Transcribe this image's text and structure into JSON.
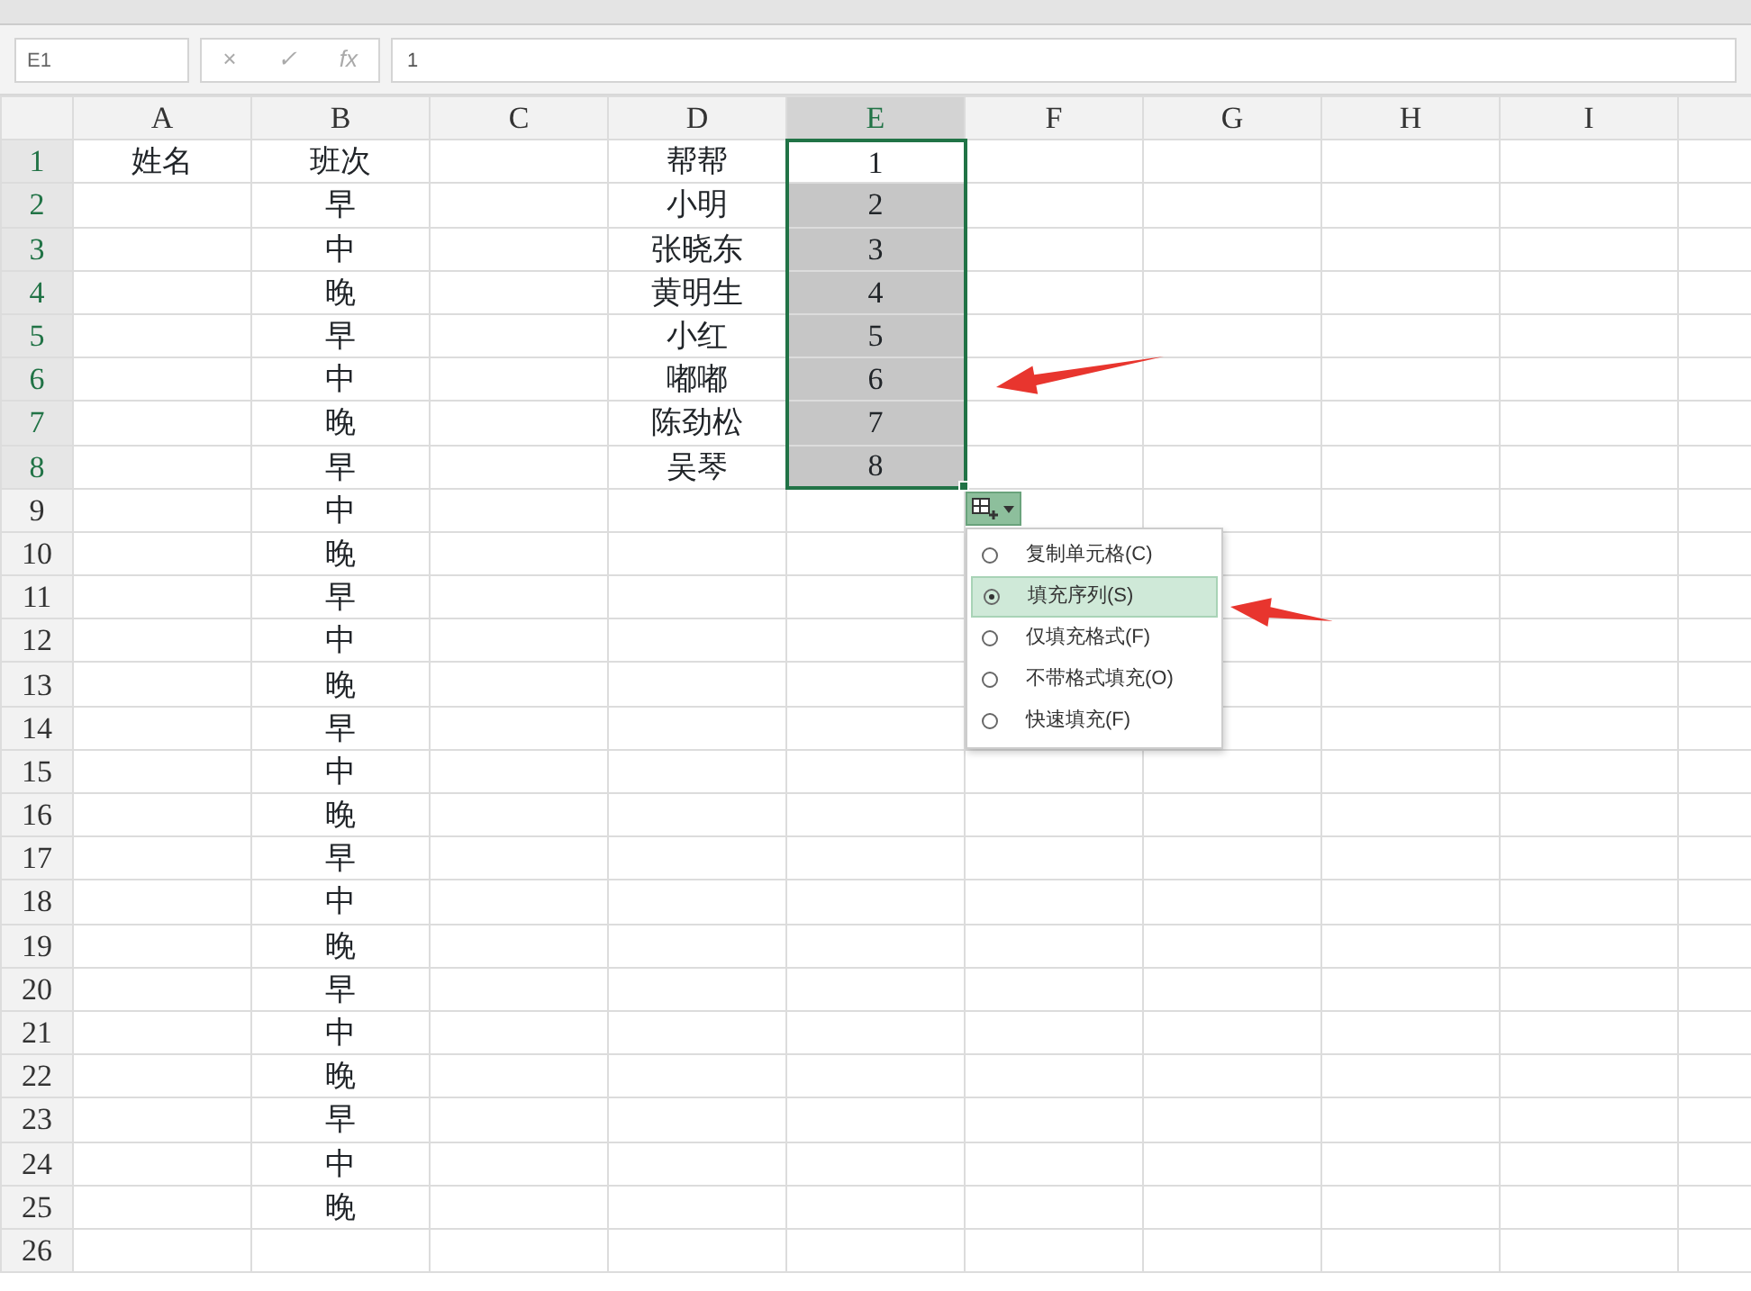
{
  "name_box": "E1",
  "formula_buttons": [
    "×",
    "✓",
    "fx"
  ],
  "formula_value": "1",
  "columns": [
    {
      "label": "A",
      "selected": false
    },
    {
      "label": "B",
      "selected": false
    },
    {
      "label": "C",
      "selected": false
    },
    {
      "label": "D",
      "selected": false
    },
    {
      "label": "E",
      "selected": true
    },
    {
      "label": "F",
      "selected": false
    },
    {
      "label": "G",
      "selected": false
    },
    {
      "label": "H",
      "selected": false
    },
    {
      "label": "I",
      "selected": false
    }
  ],
  "rows": [
    {
      "header": "1",
      "selected": true,
      "cells": [
        {
          "text": "姓名"
        },
        {
          "text": "班次"
        },
        null,
        {
          "text": "帮帮"
        },
        {
          "text": "1",
          "selected": true,
          "active": true
        }
      ]
    },
    {
      "header": "2",
      "selected": true,
      "cells": [
        null,
        {
          "text": "早"
        },
        null,
        {
          "text": "小明"
        },
        {
          "text": "2",
          "selected": true,
          "active": false
        }
      ]
    },
    {
      "header": "3",
      "selected": true,
      "cells": [
        null,
        {
          "text": "中"
        },
        null,
        {
          "text": "张晓东"
        },
        {
          "text": "3",
          "selected": true,
          "active": false
        }
      ]
    },
    {
      "header": "4",
      "selected": true,
      "cells": [
        null,
        {
          "text": "晚"
        },
        null,
        {
          "text": "黄明生"
        },
        {
          "text": "4",
          "selected": true,
          "active": false
        }
      ]
    },
    {
      "header": "5",
      "selected": true,
      "cells": [
        null,
        {
          "text": "早"
        },
        null,
        {
          "text": "小红"
        },
        {
          "text": "5",
          "selected": true,
          "active": false
        }
      ]
    },
    {
      "header": "6",
      "selected": true,
      "cells": [
        null,
        {
          "text": "中"
        },
        null,
        {
          "text": "嘟嘟"
        },
        {
          "text": "6",
          "selected": true,
          "active": false
        }
      ]
    },
    {
      "header": "7",
      "selected": true,
      "cells": [
        null,
        {
          "text": "晚"
        },
        null,
        {
          "text": "陈劲松"
        },
        {
          "text": "7",
          "selected": true,
          "active": false
        }
      ]
    },
    {
      "header": "8",
      "selected": true,
      "cells": [
        null,
        {
          "text": "早"
        },
        null,
        {
          "text": "吴琴"
        },
        {
          "text": "8",
          "selected": true,
          "active": false
        }
      ]
    },
    {
      "header": "9",
      "selected": false,
      "cells": [
        null,
        {
          "text": "中"
        }
      ]
    },
    {
      "header": "10",
      "selected": false,
      "cells": [
        null,
        {
          "text": "晚"
        }
      ]
    },
    {
      "header": "11",
      "selected": false,
      "cells": [
        null,
        {
          "text": "早"
        }
      ]
    },
    {
      "header": "12",
      "selected": false,
      "cells": [
        null,
        {
          "text": "中"
        }
      ]
    },
    {
      "header": "13",
      "selected": false,
      "cells": [
        null,
        {
          "text": "晚"
        }
      ]
    },
    {
      "header": "14",
      "selected": false,
      "cells": [
        null,
        {
          "text": "早"
        }
      ]
    },
    {
      "header": "15",
      "selected": false,
      "cells": [
        null,
        {
          "text": "中"
        }
      ]
    },
    {
      "header": "16",
      "selected": false,
      "cells": [
        null,
        {
          "text": "晚"
        }
      ]
    },
    {
      "header": "17",
      "selected": false,
      "cells": [
        null,
        {
          "text": "早"
        }
      ]
    },
    {
      "header": "18",
      "selected": false,
      "cells": [
        null,
        {
          "text": "中"
        }
      ]
    },
    {
      "header": "19",
      "selected": false,
      "cells": [
        null,
        {
          "text": "晚"
        }
      ]
    },
    {
      "header": "20",
      "selected": false,
      "cells": [
        null,
        {
          "text": "早"
        }
      ]
    },
    {
      "header": "21",
      "selected": false,
      "cells": [
        null,
        {
          "text": "中"
        }
      ]
    },
    {
      "header": "22",
      "selected": false,
      "cells": [
        null,
        {
          "text": "晚"
        }
      ]
    },
    {
      "header": "23",
      "selected": false,
      "cells": [
        null,
        {
          "text": "早"
        }
      ]
    },
    {
      "header": "24",
      "selected": false,
      "cells": [
        null,
        {
          "text": "中"
        }
      ]
    },
    {
      "header": "25",
      "selected": false,
      "cells": [
        null,
        {
          "text": "晚"
        }
      ]
    },
    {
      "header": "26",
      "selected": false
    }
  ],
  "fill_options": [
    {
      "label": "复制单元格(C)",
      "selected": false
    },
    {
      "label": "填充序列(S)",
      "selected": true
    },
    {
      "label": "仅填充格式(F)",
      "selected": false
    },
    {
      "label": "不带格式填充(O)",
      "selected": false
    },
    {
      "label": "快速填充(F)",
      "selected": false
    }
  ]
}
